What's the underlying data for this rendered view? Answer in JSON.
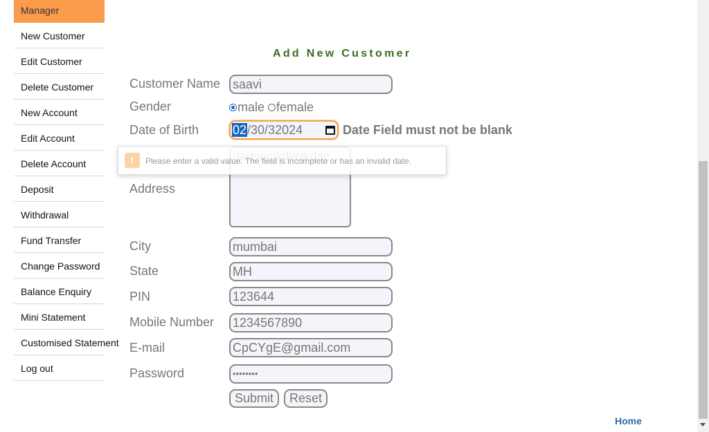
{
  "sidebar": {
    "header": "Manager",
    "items": [
      {
        "label": "New Customer",
        "name": "sidebar-item-new-customer"
      },
      {
        "label": "Edit Customer",
        "name": "sidebar-item-edit-customer"
      },
      {
        "label": "Delete Customer",
        "name": "sidebar-item-delete-customer"
      },
      {
        "label": "New Account",
        "name": "sidebar-item-new-account"
      },
      {
        "label": "Edit Account",
        "name": "sidebar-item-edit-account"
      },
      {
        "label": "Delete Account",
        "name": "sidebar-item-delete-account"
      },
      {
        "label": "Deposit",
        "name": "sidebar-item-deposit"
      },
      {
        "label": "Withdrawal",
        "name": "sidebar-item-withdrawal"
      },
      {
        "label": "Fund Transfer",
        "name": "sidebar-item-fund-transfer"
      },
      {
        "label": "Change Password",
        "name": "sidebar-item-change-password"
      },
      {
        "label": "Balance Enquiry",
        "name": "sidebar-item-balance-enquiry"
      },
      {
        "label": "Mini Statement",
        "name": "sidebar-item-mini-statement"
      },
      {
        "label": "Customised Statement",
        "name": "sidebar-item-customised-statement"
      },
      {
        "label": "Log out",
        "name": "sidebar-item-log-out"
      }
    ]
  },
  "form": {
    "heading": "Add New Customer",
    "customer_name": {
      "label": "Customer Name",
      "value": "saavi"
    },
    "gender": {
      "label": "Gender",
      "options": [
        "male",
        "female"
      ],
      "selected": "male"
    },
    "dob": {
      "label": "Date of Birth",
      "month": "02",
      "rest": "/30/32024",
      "error": "Date Field must not be blank"
    },
    "address": {
      "label": "Address",
      "value": "gadsncjkdscjkdsc"
    },
    "city": {
      "label": "City",
      "value": "mumbai"
    },
    "state": {
      "label": "State",
      "value": "MH"
    },
    "pin": {
      "label": "PIN",
      "value": "123644"
    },
    "mobile": {
      "label": "Mobile Number",
      "value": "1234567890"
    },
    "email": {
      "label": "E-mail",
      "value": "CpCYgE@gmail.com"
    },
    "password": {
      "label": "Password",
      "value": "••••••••"
    },
    "submit_label": "Submit",
    "reset_label": "Reset"
  },
  "tooltip": {
    "icon": "!",
    "message": "Please enter a valid value. The field is incomplete or has an invalid date."
  },
  "footer": {
    "home_label": "Home"
  },
  "colors": {
    "sidebar_header": "#fb9c4c",
    "heading": "#3a6b1e",
    "link": "#2d6aa0",
    "focus": "#f7a34a"
  }
}
